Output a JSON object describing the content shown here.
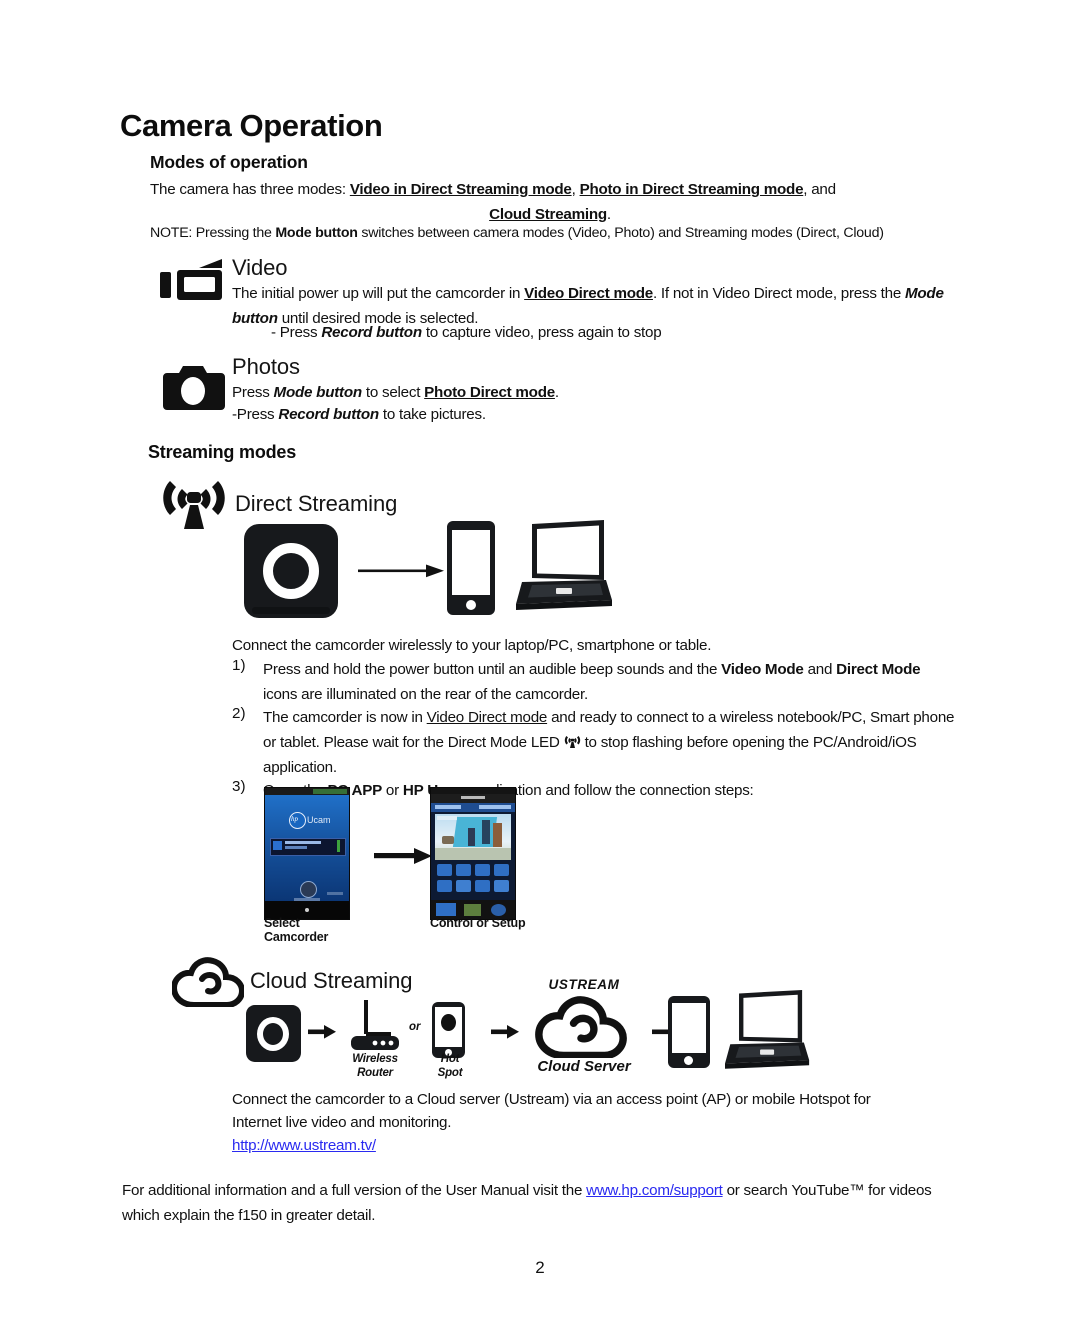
{
  "document": {
    "page_number": "2",
    "title": "Camera Operation"
  },
  "modes_of_operation": {
    "heading": "Modes of operation",
    "intro_prefix": "The camera has three modes: ",
    "mode_1": "Video in Direct Streaming mode",
    "intro_sep_1": ", ",
    "mode_2": "Photo in Direct Streaming mode",
    "intro_sep_2": ", and",
    "mode_3": "Cloud Streaming",
    "intro_suffix": ".",
    "note_prefix": "NOTE: Pressing the ",
    "note_bold": "Mode button",
    "note_suffix": " switches between camera modes (Video, Photo) and Streaming modes (Direct, Cloud)"
  },
  "video": {
    "heading": "Video",
    "icon": "camcorder-icon",
    "line1_a": "The initial power up will put the camcorder in ",
    "line1_bold": "Video Direct mode",
    "line1_b": ".  If not in Video Direct mode, press the ",
    "line1_bolditalic": "Mode button",
    "line1_c": " until desired mode is selected.",
    "bullet_a": "- Press ",
    "bullet_bolditalic": "Record button",
    "bullet_b": " to capture video, press again to stop"
  },
  "photos": {
    "heading": "Photos",
    "icon": "camera-icon",
    "line1_a": "Press ",
    "line1_bolditalic": "Mode button",
    "line1_b": " to select ",
    "line1_bold": "Photo Direct mode",
    "line1_c": ".",
    "line2_a": "-Press ",
    "line2_bolditalic": "Record button",
    "line2_b": " to take pictures."
  },
  "streaming_modes": {
    "heading": "Streaming modes"
  },
  "direct_streaming": {
    "heading": "Direct Streaming",
    "icon": "wifi-antenna-icon",
    "diagram": {
      "camcorder": "camcorder-module-icon",
      "arrow": "arrow-right-icon",
      "phone": "smartphone-icon",
      "laptop": "laptop-icon"
    },
    "intro": "Connect the camcorder wirelessly to your laptop/PC, smartphone or table.",
    "steps": [
      {
        "num": "1)",
        "a": "Press and hold the power button until an audible beep sounds and the ",
        "bold1": "Video Mode",
        "b": " and ",
        "bold2": "Direct Mode",
        "c": " icons are illuminated on the rear of the camcorder."
      },
      {
        "num": "2)",
        "a": "The camcorder is now in ",
        "underline": "Video Direct mode",
        "b": " and ready to connect to a wireless notebook/PC, Smart phone or tablet.  Please wait for the Direct Mode LED ",
        "inline_icon": "wifi-antenna-icon",
        "c": " to stop flashing before opening the PC/Android/iOS application."
      },
      {
        "num": "3)",
        "a": "Open the ",
        "bold1": "PC APP",
        "b": " or ",
        "bold2": "HP Ucam",
        "c": " application and follow the connection steps:"
      }
    ],
    "app_screens": {
      "screen1_brand": "Ucam",
      "screen1_caption_line1": "Select",
      "screen1_caption_line2": "Camcorder",
      "screen2_caption": "Control or Setup",
      "arrow": "arrow-right-icon"
    }
  },
  "cloud_streaming": {
    "heading": "Cloud Streaming",
    "icon": "cloud-icon",
    "diagram": {
      "camcorder": "camcorder-module-icon",
      "router_caption_line1": "Wireless",
      "router_caption_line2": "Router",
      "or_label": "or",
      "hotspot_caption_line1": "Hot",
      "hotspot_caption_line2": "Spot",
      "ustream_label": "USTREAM",
      "cloud_server_label": "Cloud Server",
      "phone": "smartphone-icon",
      "laptop": "laptop-icon"
    },
    "body_line1": "Connect the camcorder to a Cloud server (Ustream) via an access point (AP) or mobile Hotspot for",
    "body_line2": "Internet live video and monitoring.",
    "link": "http://www.ustream.tv/"
  },
  "footer": {
    "a": "For additional information and a full version of the User Manual visit the ",
    "link": "www.hp.com/support",
    "b": " or search YouTube™ for videos which explain the f150 in greater detail."
  },
  "colors": {
    "ink": "#111111",
    "link": "#2a2af0",
    "device": "#17191c",
    "screen_blue": "#0a2a6b"
  }
}
